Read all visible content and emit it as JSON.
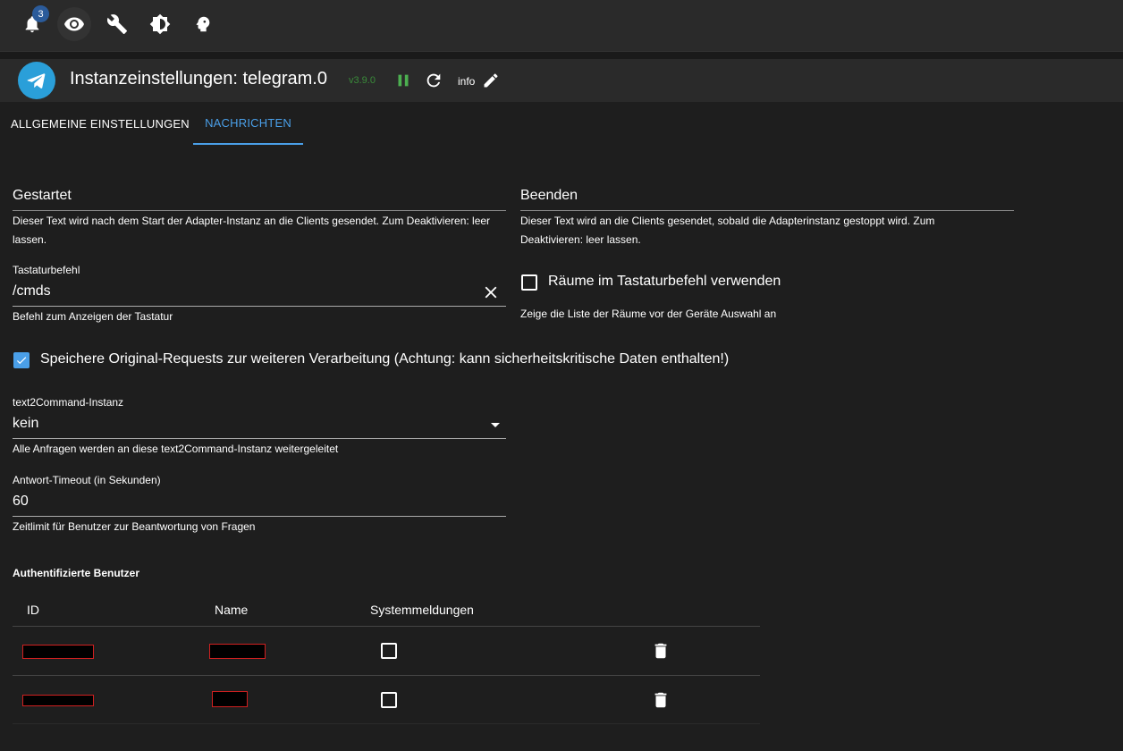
{
  "topbar": {
    "notification_count": "3",
    "icons": [
      "bell-icon",
      "eye-icon",
      "wrench-icon",
      "brightness-icon",
      "expert-head-icon"
    ]
  },
  "header": {
    "title": "Instanzeinstellungen: telegram.0",
    "version": "v3.9.0",
    "info_label": "info",
    "logo_icon": "telegram-icon",
    "colors": {
      "version": "#3a8b3a",
      "pause": "#4caf50",
      "logo": "#2a9fd9"
    }
  },
  "tabs": [
    {
      "label": "ALLGEMEINE EINSTELLUNGEN",
      "active": false
    },
    {
      "label": "NACHRICHTEN",
      "active": true
    }
  ],
  "accent_color": "#4a9fe8",
  "form": {
    "started": {
      "title": "Gestartet",
      "help": "Dieser Text wird nach dem Start der Adapter-Instanz an die Clients gesendet. Zum Deaktivieren: leer lassen."
    },
    "stopped": {
      "title": "Beenden",
      "help": "Dieser Text wird an die Clients gesendet, sobald die Adapterinstanz gestoppt wird. Zum Deaktivieren: leer lassen."
    },
    "keyboard_command": {
      "label": "Tastaturbefehl",
      "value": "/cmds",
      "help": "Befehl zum Anzeigen der Tastatur"
    },
    "rooms": {
      "label": "Räume im Tastaturbefehl verwenden",
      "checked": false,
      "help": "Zeige die Liste der Räume vor der Geräte Auswahl an"
    },
    "save_raw": {
      "label": "Speichere Original-Requests zur weiteren Verarbeitung (Achtung: kann sicherheitskritische Daten enthalten!)",
      "checked": true
    },
    "text2command": {
      "label": "text2Command-Instanz",
      "value": "kein",
      "help": "Alle Anfragen werden an diese text2Command-Instanz weitergeleitet"
    },
    "timeout": {
      "label": "Antwort-Timeout (in Sekunden)",
      "value": "60",
      "help": "Zeitlimit für Benutzer zur Beantwortung von Fragen"
    }
  },
  "users": {
    "heading": "Authentifizierte Benutzer",
    "columns": [
      "ID",
      "Name",
      "Systemmeldungen"
    ],
    "rows": [
      {
        "id": "",
        "name": "",
        "system_messages": false
      },
      {
        "id": "",
        "name": "",
        "system_messages": false
      }
    ]
  }
}
